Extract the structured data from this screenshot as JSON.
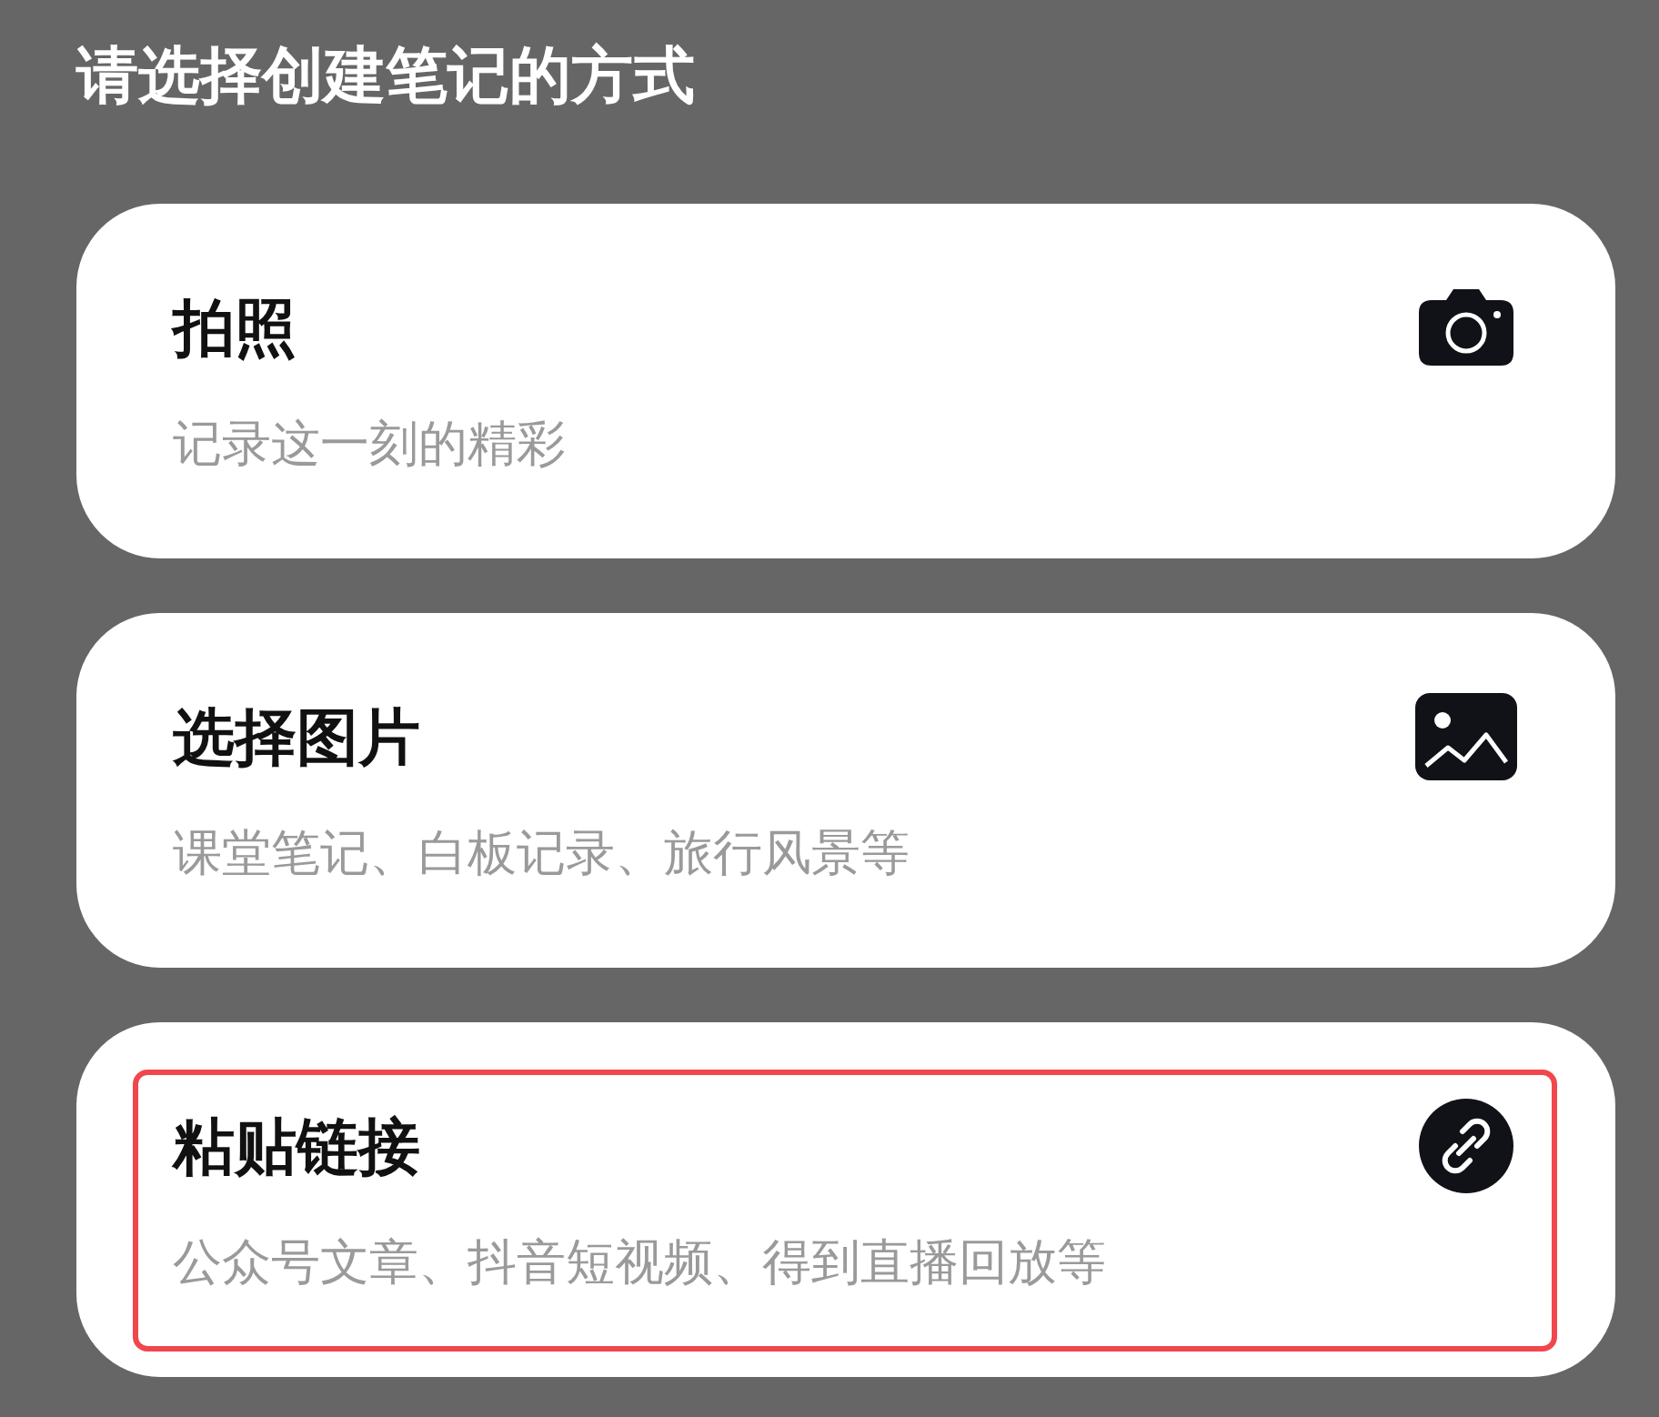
{
  "title": "请选择创建笔记的方式",
  "options": [
    {
      "label": "拍照",
      "description": "记录这一刻的精彩",
      "kind": "camera",
      "highlighted": false
    },
    {
      "label": "选择图片",
      "description": "课堂笔记、白板记录、旅行风景等",
      "kind": "image",
      "highlighted": false
    },
    {
      "label": "粘贴链接",
      "description": "公众号文章、抖音短视频、得到直播回放等",
      "kind": "link",
      "highlighted": true
    }
  ]
}
